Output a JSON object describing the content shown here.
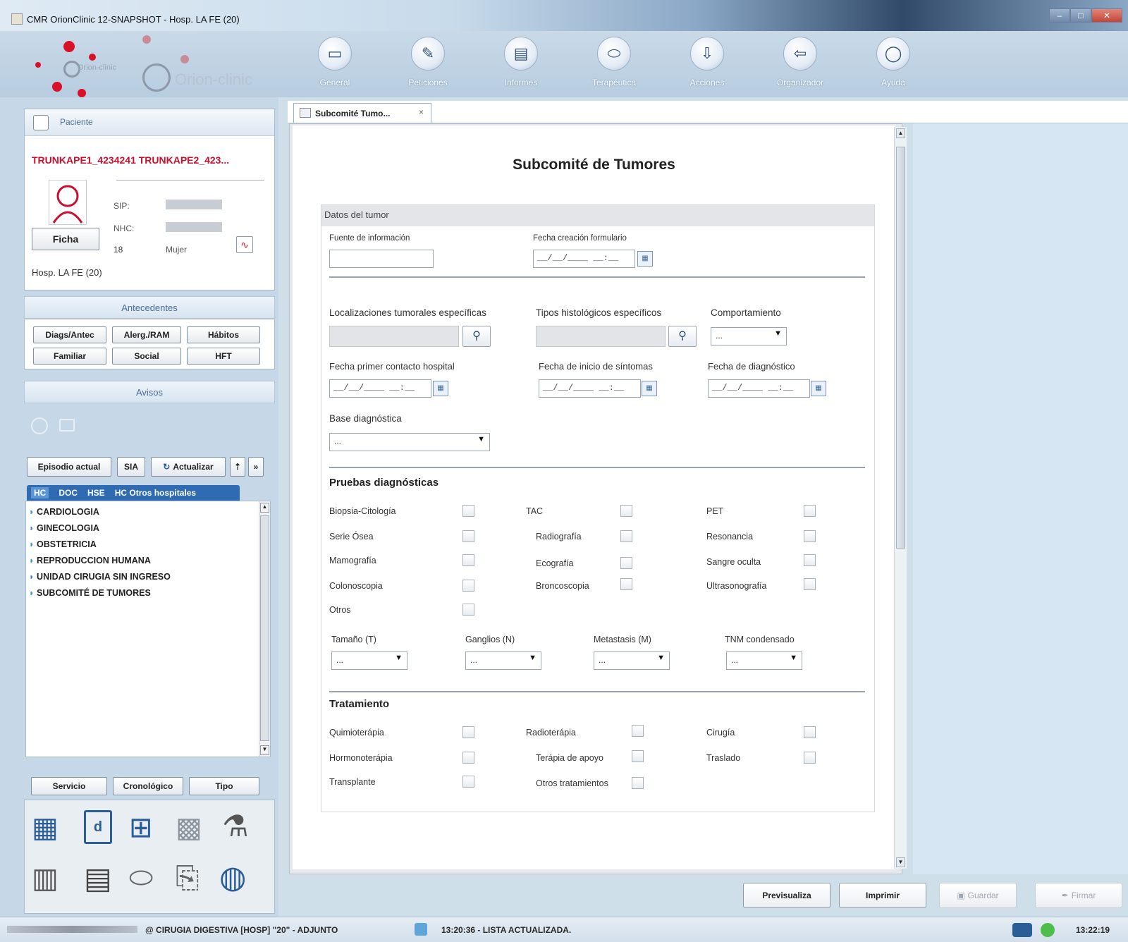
{
  "window": {
    "title": "CMR OrionClinic 12-SNAPSHOT - Hosp. LA FE (20)",
    "controls": [
      "minimize",
      "maximize",
      "close"
    ]
  },
  "logo": {
    "small_text": "Orion-clinic",
    "big_text": "Orion-clinic"
  },
  "toolbar": {
    "items": [
      {
        "label": "General",
        "icon": "laptop-icon"
      },
      {
        "label": "Peticiones",
        "icon": "pencil-icon"
      },
      {
        "label": "Informes",
        "icon": "document-icon"
      },
      {
        "label": "Terapéutica",
        "icon": "pill-icon"
      },
      {
        "label": "Acciones",
        "icon": "download-icon"
      },
      {
        "label": "Organizador",
        "icon": "back-arrow-icon"
      },
      {
        "label": "Ayuda",
        "icon": "speech-bubble-icon"
      }
    ]
  },
  "patient": {
    "header": "Paciente",
    "name": "TRUNKAPE1_4234241 TRUNKAPE2_423...",
    "sip_label": "SIP:",
    "nhc_label": "NHC:",
    "age": "18",
    "sex": "Mujer",
    "ficha_button": "Ficha",
    "hospital": "Hosp. LA FE (20)"
  },
  "antecedentes": {
    "header": "Antecedentes",
    "buttons": [
      "Diags/Antec",
      "Alerg./RAM",
      "Hábitos",
      "Familiar",
      "Social",
      "HFT"
    ]
  },
  "avisos": {
    "header": "Avisos"
  },
  "episodes": {
    "buttons": [
      "Episodio actual",
      "SIA",
      "Actualizar"
    ],
    "tabs": [
      "HC",
      "DOC",
      "HSE",
      "HC Otros hospitales"
    ],
    "tree": [
      "CARDIOLOGIA",
      "GINECOLOGIA",
      "OBSTETRICIA",
      "REPRODUCCION HUMANA",
      "UNIDAD CIRUGIA SIN INGRESO",
      "SUBCOMITÉ DE TUMORES"
    ],
    "sort_buttons": [
      "Servicio",
      "Cronológico",
      "Tipo"
    ]
  },
  "tab": {
    "label": "Subcomité Tumo...",
    "close": "×"
  },
  "form": {
    "title": "Subcomité de Tumores",
    "section_header": "Datos del tumor",
    "fuente_label": "Fuente de información",
    "fecha_creacion_label": "Fecha creación formulario",
    "date_mask": "__/__/____ __:__",
    "localizaciones_label": "Localizaciones tumorales específicas",
    "tipos_label": "Tipos histológicos específicos",
    "comportamiento_label": "Comportamiento",
    "select_default": "...",
    "fecha_contacto_label": "Fecha primer contacto hospital",
    "fecha_inicio_label": "Fecha de inicio de síntomas",
    "fecha_diag_label": "Fecha de diagnóstico",
    "base_diag_label": "Base diagnóstica",
    "pruebas_title": "Pruebas diagnósticas",
    "pruebas": [
      [
        "Biopsia-Citología",
        "TAC",
        "PET"
      ],
      [
        "Serie Ósea",
        "Radiografía",
        "Resonancia"
      ],
      [
        "Mamografía",
        "Ecografía",
        "Sangre oculta"
      ],
      [
        "Colonoscopia",
        "Broncoscopia",
        "Ultrasonografía"
      ],
      [
        "Otros"
      ]
    ],
    "tnm_labels": [
      "Tamaño (T)",
      "Ganglios (N)",
      "Metastasis (M)",
      "TNM condensado"
    ],
    "tratamiento_title": "Tratamiento",
    "tratamientos": [
      [
        "Quimioterápia",
        "Radioterápia",
        "Cirugía"
      ],
      [
        "Hormonoterápia",
        "Terápia de apoyo",
        "Traslado"
      ],
      [
        "Transplante",
        "Otros tratamientos"
      ]
    ]
  },
  "actions": {
    "preview": "Previsualiza",
    "print": "Imprimir",
    "save": "Guardar",
    "sign": "Firmar"
  },
  "status": {
    "service": "@ CIRUGIA DIGESTIVA [HOSP] \"20\" - ADJUNTO",
    "message": "13:20:36 - LISTA ACTUALIZADA.",
    "clock": "13:22:19"
  }
}
